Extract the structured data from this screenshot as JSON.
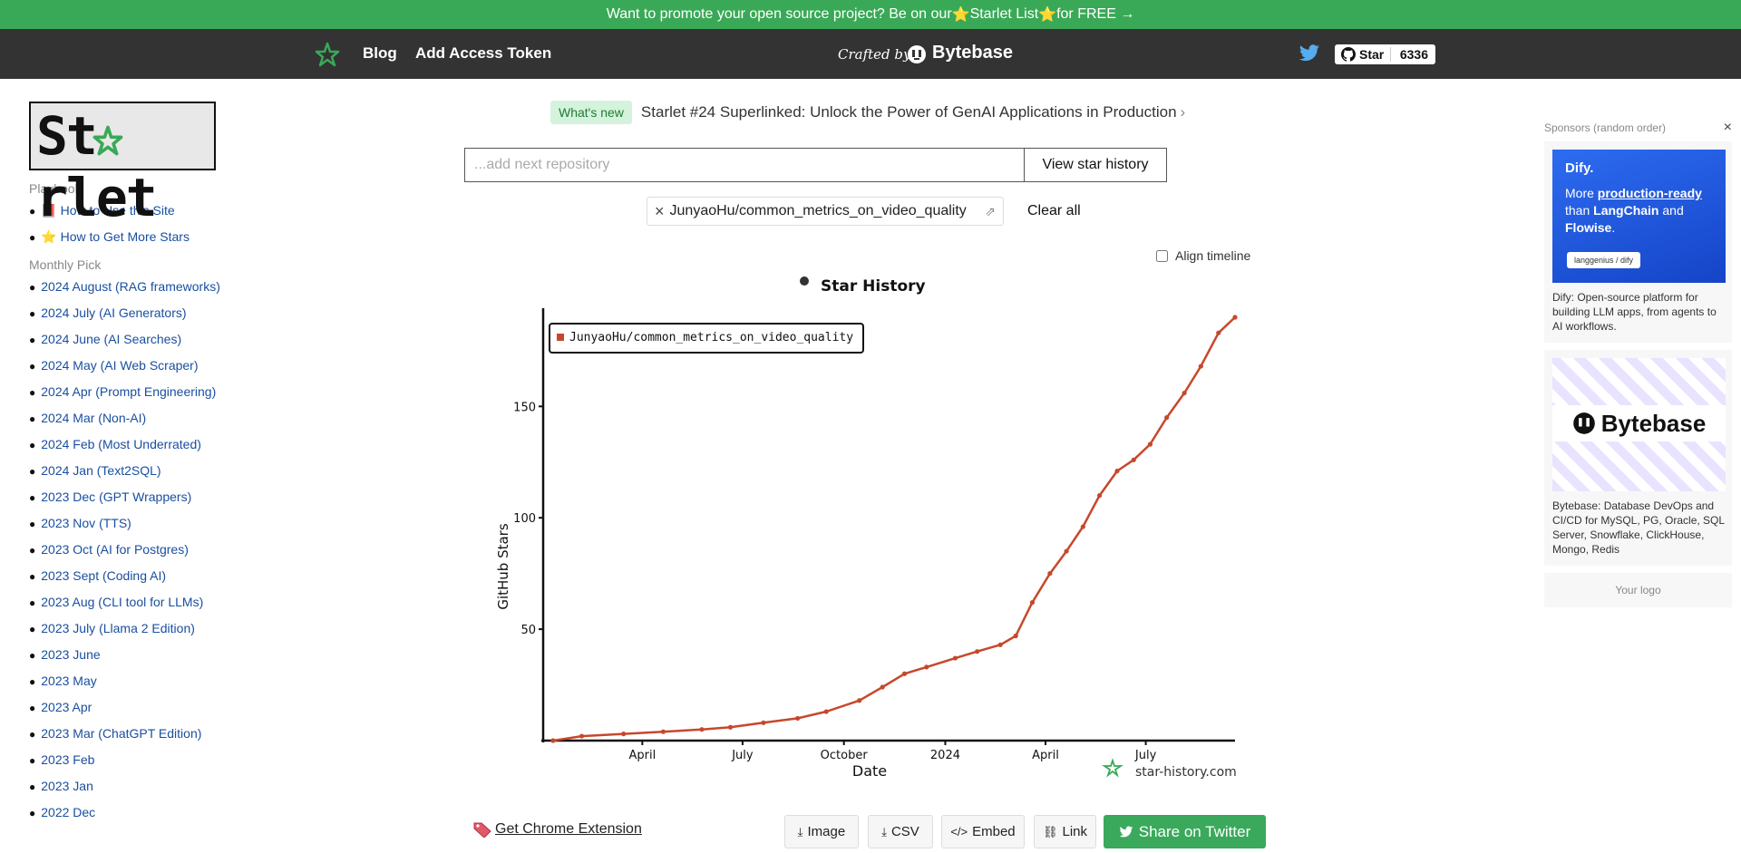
{
  "promo": {
    "prefix": "Want to promote your open source project? Be on our ",
    "star1": "⭐",
    "link": "Starlet List",
    "star2": "⭐",
    "suffix": " for FREE →"
  },
  "header": {
    "nav_blog": "Blog",
    "nav_token": "Add Access Token",
    "crafted": "Crafted by",
    "brand": "Bytebase",
    "github_star_label": "Star",
    "github_star_count": "6336"
  },
  "sidebar": {
    "brand": "St rlet",
    "playbook_title": "Playbook",
    "playbook": [
      {
        "icon": "📕",
        "label": "How to Use this Site"
      },
      {
        "icon": "⭐",
        "label": "How to Get More Stars"
      }
    ],
    "monthly_title": "Monthly Pick",
    "monthly": [
      "2024 August (RAG frameworks)",
      "2024 July (AI Generators)",
      "2024 June (AI Searches)",
      "2024 May (AI Web Scraper)",
      "2024 Apr (Prompt Engineering)",
      "2024 Mar (Non-AI)",
      "2024 Feb (Most Underrated)",
      "2024 Jan (Text2SQL)",
      "2023 Dec (GPT Wrappers)",
      "2023 Nov (TTS)",
      "2023 Oct (AI for Postgres)",
      "2023 Sept (Coding AI)",
      "2023 Aug (CLI tool for LLMs)",
      "2023 July (Llama 2 Edition)",
      "2023 June",
      "2023 May",
      "2023 Apr",
      "2023 Mar (ChatGPT Edition)",
      "2023 Feb",
      "2023 Jan",
      "2022 Dec"
    ]
  },
  "whats_new": {
    "badge": "What's new",
    "title": "Starlet #24 Superlinked: Unlock the Power of GenAI Applications in Production",
    "chevron": "›"
  },
  "search": {
    "placeholder": "...add next repository",
    "value": "",
    "button": "View star history"
  },
  "repo_chip": {
    "name": "JunyaoHu/common_metrics_on_video_quality",
    "remove": "×",
    "external": "⇗"
  },
  "clear_all": "Clear all",
  "align_timeline": {
    "label": "Align timeline",
    "checked": false
  },
  "chart_data": {
    "type": "line",
    "title": "Star History",
    "xlabel": "Date",
    "ylabel": "GitHub Stars",
    "x_ticks": [
      "April",
      "July",
      "October",
      "2024",
      "April",
      "July"
    ],
    "y_ticks": [
      50,
      100,
      150
    ],
    "ylim": [
      0,
      190
    ],
    "legend_position": "top-left",
    "watermark": "star-history.com",
    "series": [
      {
        "name": "JunyaoHu/common_metrics_on_video_quality",
        "color": "#c6482b",
        "x": [
          "2023-01-10",
          "2023-02-05",
          "2023-03-15",
          "2023-04-20",
          "2023-05-25",
          "2023-06-20",
          "2023-07-20",
          "2023-08-20",
          "2023-09-15",
          "2023-10-15",
          "2023-11-05",
          "2023-11-25",
          "2023-12-15",
          "2024-01-10",
          "2024-01-30",
          "2024-02-20",
          "2024-03-05",
          "2024-03-20",
          "2024-04-05",
          "2024-04-20",
          "2024-05-05",
          "2024-05-20",
          "2024-06-05",
          "2024-06-20",
          "2024-07-05",
          "2024-07-20",
          "2024-08-05",
          "2024-08-20",
          "2024-09-05",
          "2024-09-20"
        ],
        "y": [
          0,
          2,
          3,
          4,
          5,
          6,
          8,
          10,
          13,
          18,
          24,
          30,
          33,
          37,
          40,
          43,
          47,
          62,
          75,
          85,
          96,
          110,
          121,
          126,
          133,
          145,
          156,
          168,
          183,
          190
        ]
      }
    ]
  },
  "footer_actions": {
    "chrome_ext": "Get Chrome Extension",
    "image": "Image",
    "csv": "CSV",
    "embed": "Embed",
    "link": "Link",
    "twitter": "Share on Twitter"
  },
  "sponsors": {
    "head": "Sponsors (random order)",
    "close": "×",
    "dify_logo": "Dify.",
    "dify_more": "More ",
    "dify_prod": "production-ready",
    "dify_than": " than ",
    "dify_lc": "LangChain",
    "dify_and": " and ",
    "dify_flowise": "Flowise",
    "dify_tag": "langgenius / dify",
    "dify_desc": "Dify: Open-source platform for building LLM apps, from agents to AI workflows.",
    "bytebase_name": "Bytebase",
    "bytebase_desc": "Bytebase: Database DevOps and CI/CD for MySQL, PG, Oracle, SQL Server, Snowflake, ClickHouse, Mongo, Redis",
    "your_logo": "Your logo"
  }
}
